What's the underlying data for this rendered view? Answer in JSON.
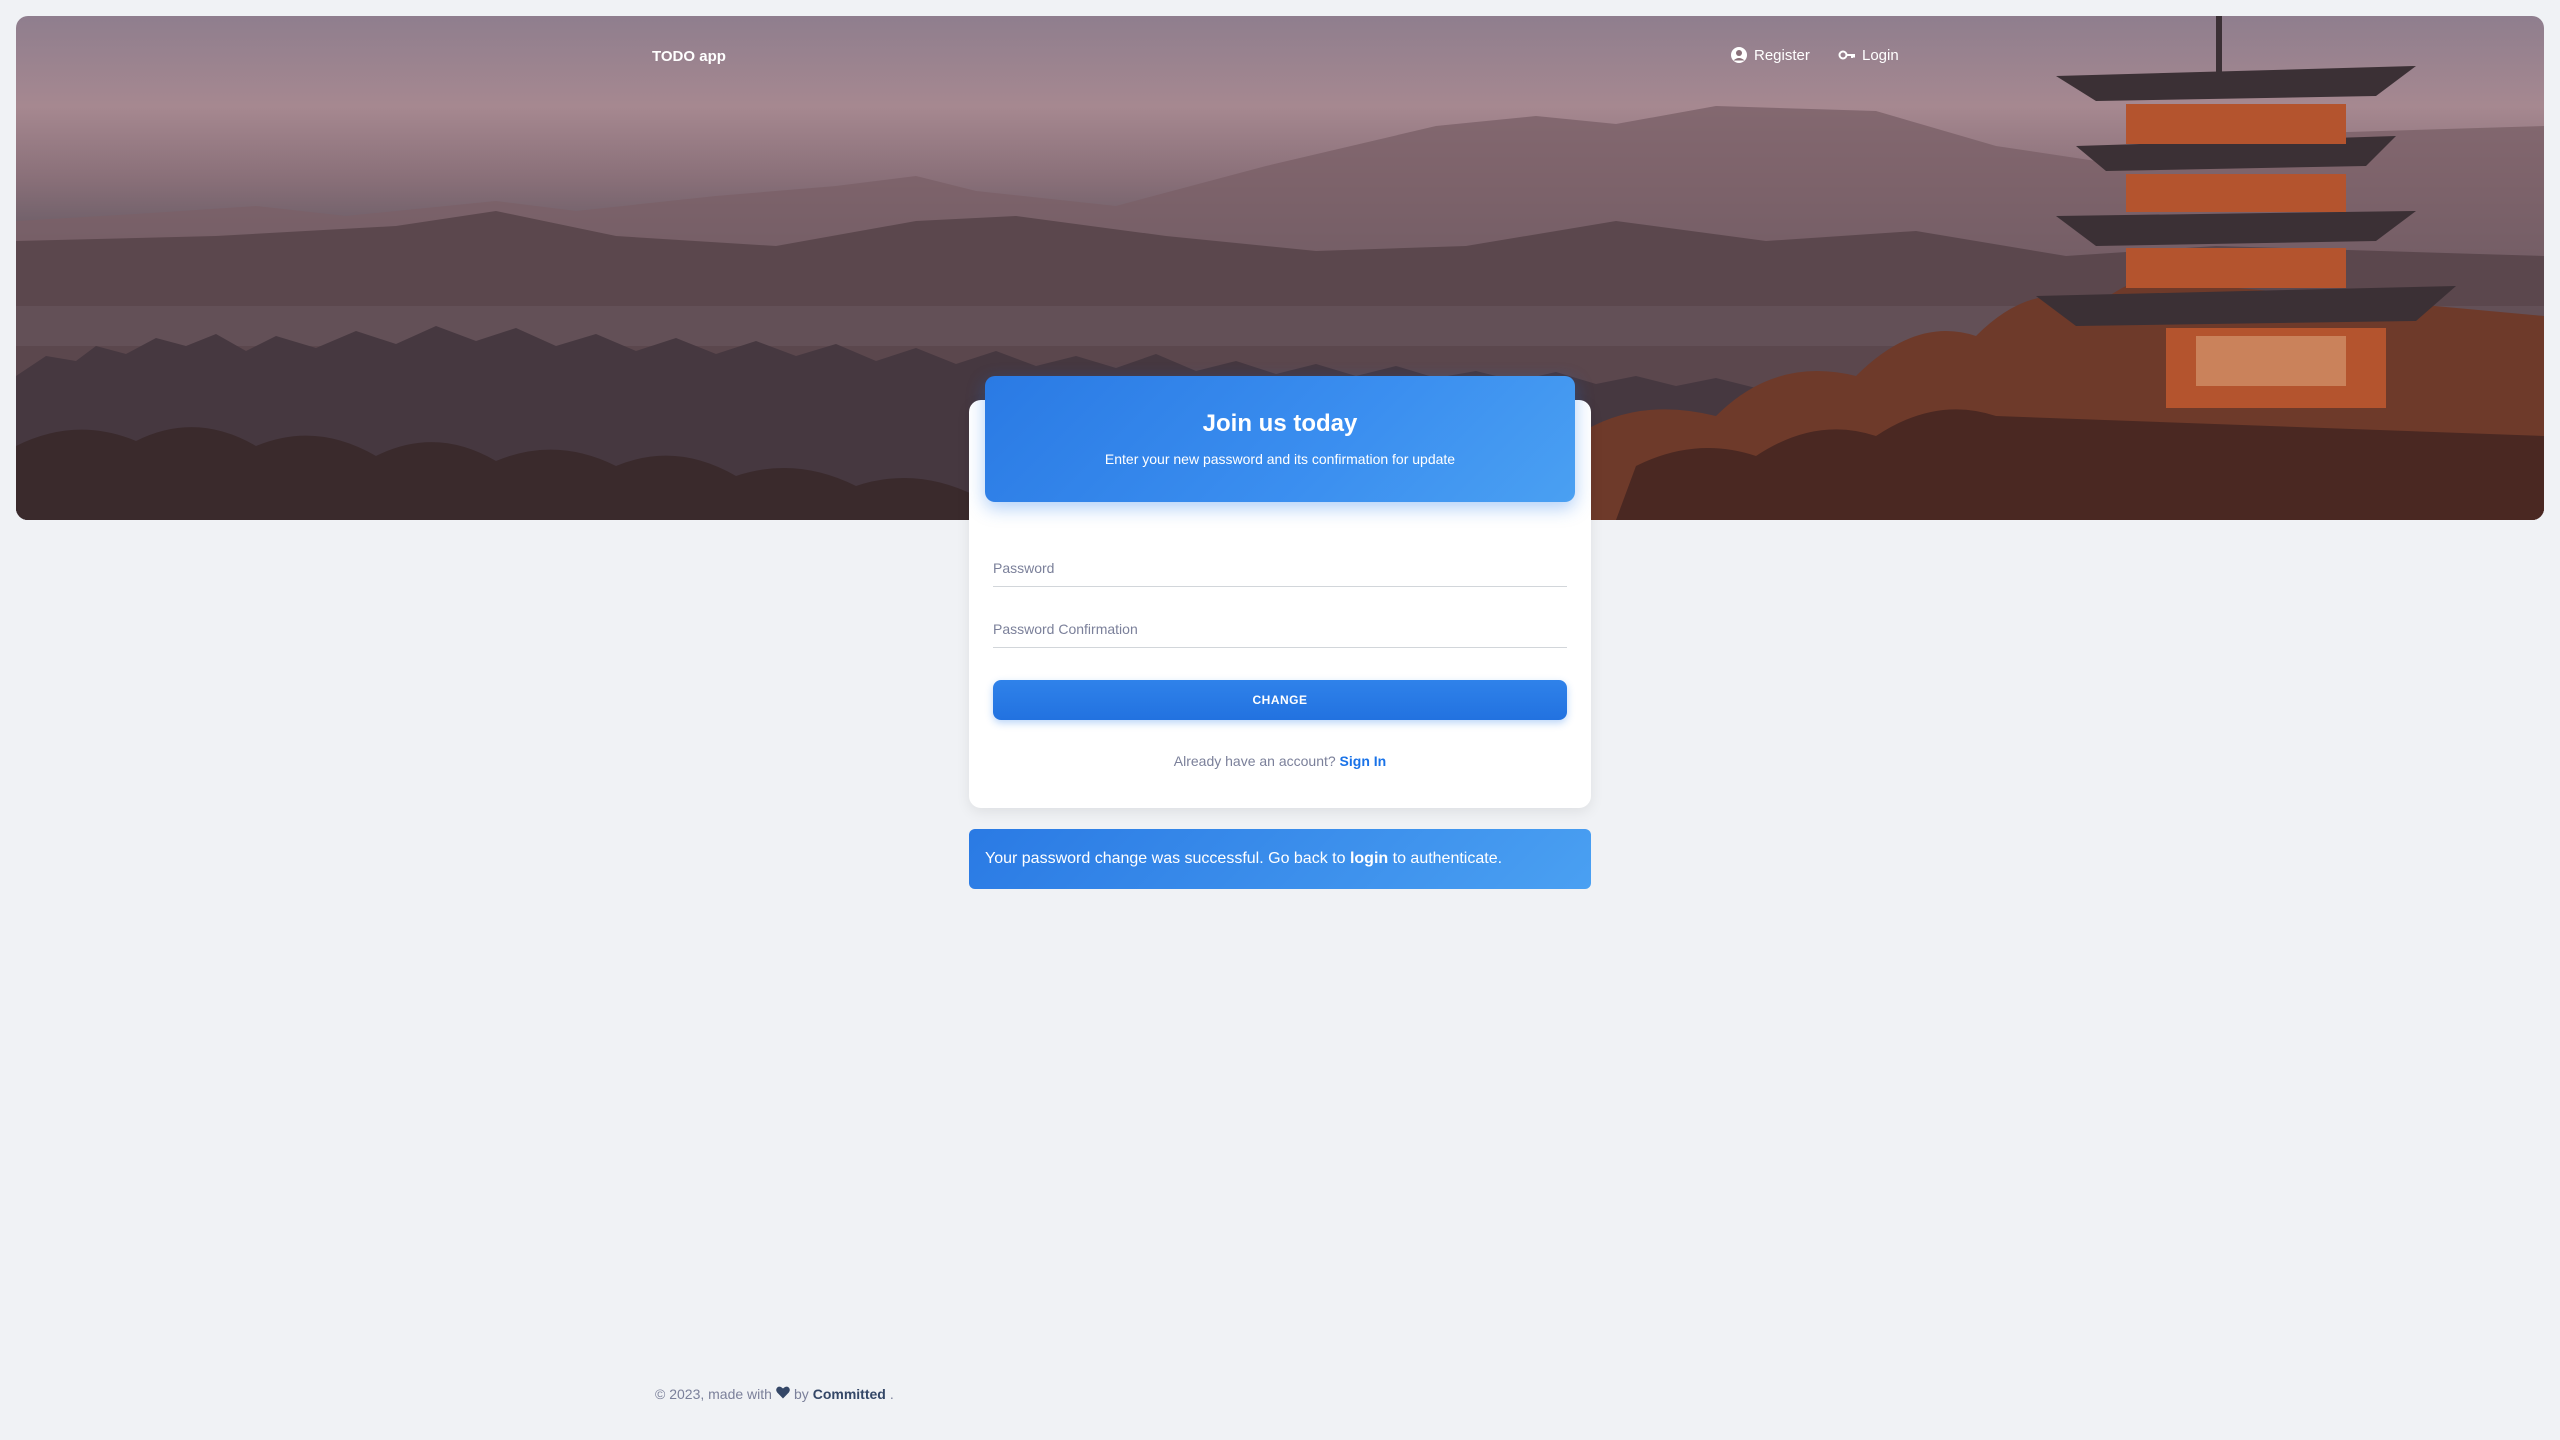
{
  "nav": {
    "brand": "TODO app",
    "register_label": "Register",
    "login_label": "Login"
  },
  "card": {
    "title": "Join us today",
    "subtitle": "Enter your new password and its confirmation for update",
    "password_placeholder": "Password",
    "password_confirmation_placeholder": "Password Confirmation",
    "submit_label": "CHANGE",
    "already_text": "Already have an account?",
    "sign_in_label": "Sign In"
  },
  "alert": {
    "text_before": "Your password change was successful. Go back to",
    "link_label": "login",
    "text_after": "to authenticate."
  },
  "footer": {
    "prefix": "© 2023, made with",
    "by": "by",
    "company": "Committed",
    "suffix": "."
  },
  "colors": {
    "primary": "#1a73e8",
    "background": "#f0f2f5",
    "muted_text": "#7b809a",
    "dark_text": "#344767"
  },
  "icons": {
    "register": "user-circle-icon",
    "login": "key-icon",
    "footer": "heart-icon"
  }
}
